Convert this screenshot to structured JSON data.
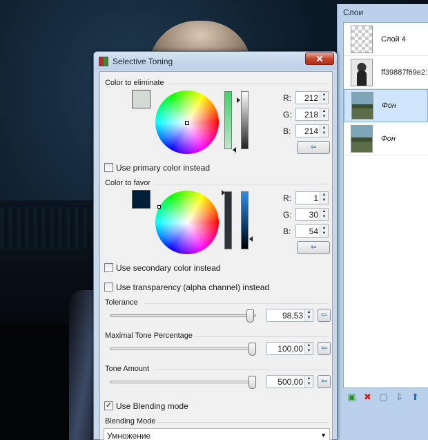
{
  "layers_panel": {
    "title": "Слои",
    "layers": [
      {
        "name": "Слой 4",
        "italic": false,
        "selected": false
      },
      {
        "name": "ff39887f69e2:",
        "italic": false,
        "selected": false
      },
      {
        "name": "Фон",
        "italic": true,
        "selected": true
      },
      {
        "name": "Фон",
        "italic": true,
        "selected": false
      }
    ]
  },
  "dialog": {
    "title": "Selective Toning",
    "close_label": "✕",
    "eliminate": {
      "label": "Color to eliminate",
      "color": "#d4dad6",
      "r_label": "R:",
      "g_label": "G:",
      "b_label": "B:",
      "r": "212",
      "g": "218",
      "b": "214",
      "checkbox_label": "Use primary color instead",
      "checked": false
    },
    "favor": {
      "label": "Color to favor",
      "color": "#011e36",
      "r_label": "R:",
      "g_label": "G:",
      "b_label": "B:",
      "r": "1",
      "g": "30",
      "b": "54",
      "checkbox_label": "Use secondary color instead",
      "checked": false
    },
    "transparency": {
      "label": "Use transparency (alpha channel) instead",
      "checked": false
    },
    "tolerance": {
      "label": "Tolerance",
      "value": "98,53",
      "fraction": 0.985
    },
    "max_tone": {
      "label": "Maximal Tone Percentage",
      "value": "100,00",
      "fraction": 1.0
    },
    "tone_amount": {
      "label": "Tone Amount",
      "value": "500,00",
      "fraction": 1.0
    },
    "blending": {
      "label": "Use Blending mode",
      "checked": true
    },
    "blending_mode": {
      "label": "Blending Mode",
      "value": "Умножение"
    },
    "apply_glyph": "⇦",
    "check_glyph": "✓"
  }
}
